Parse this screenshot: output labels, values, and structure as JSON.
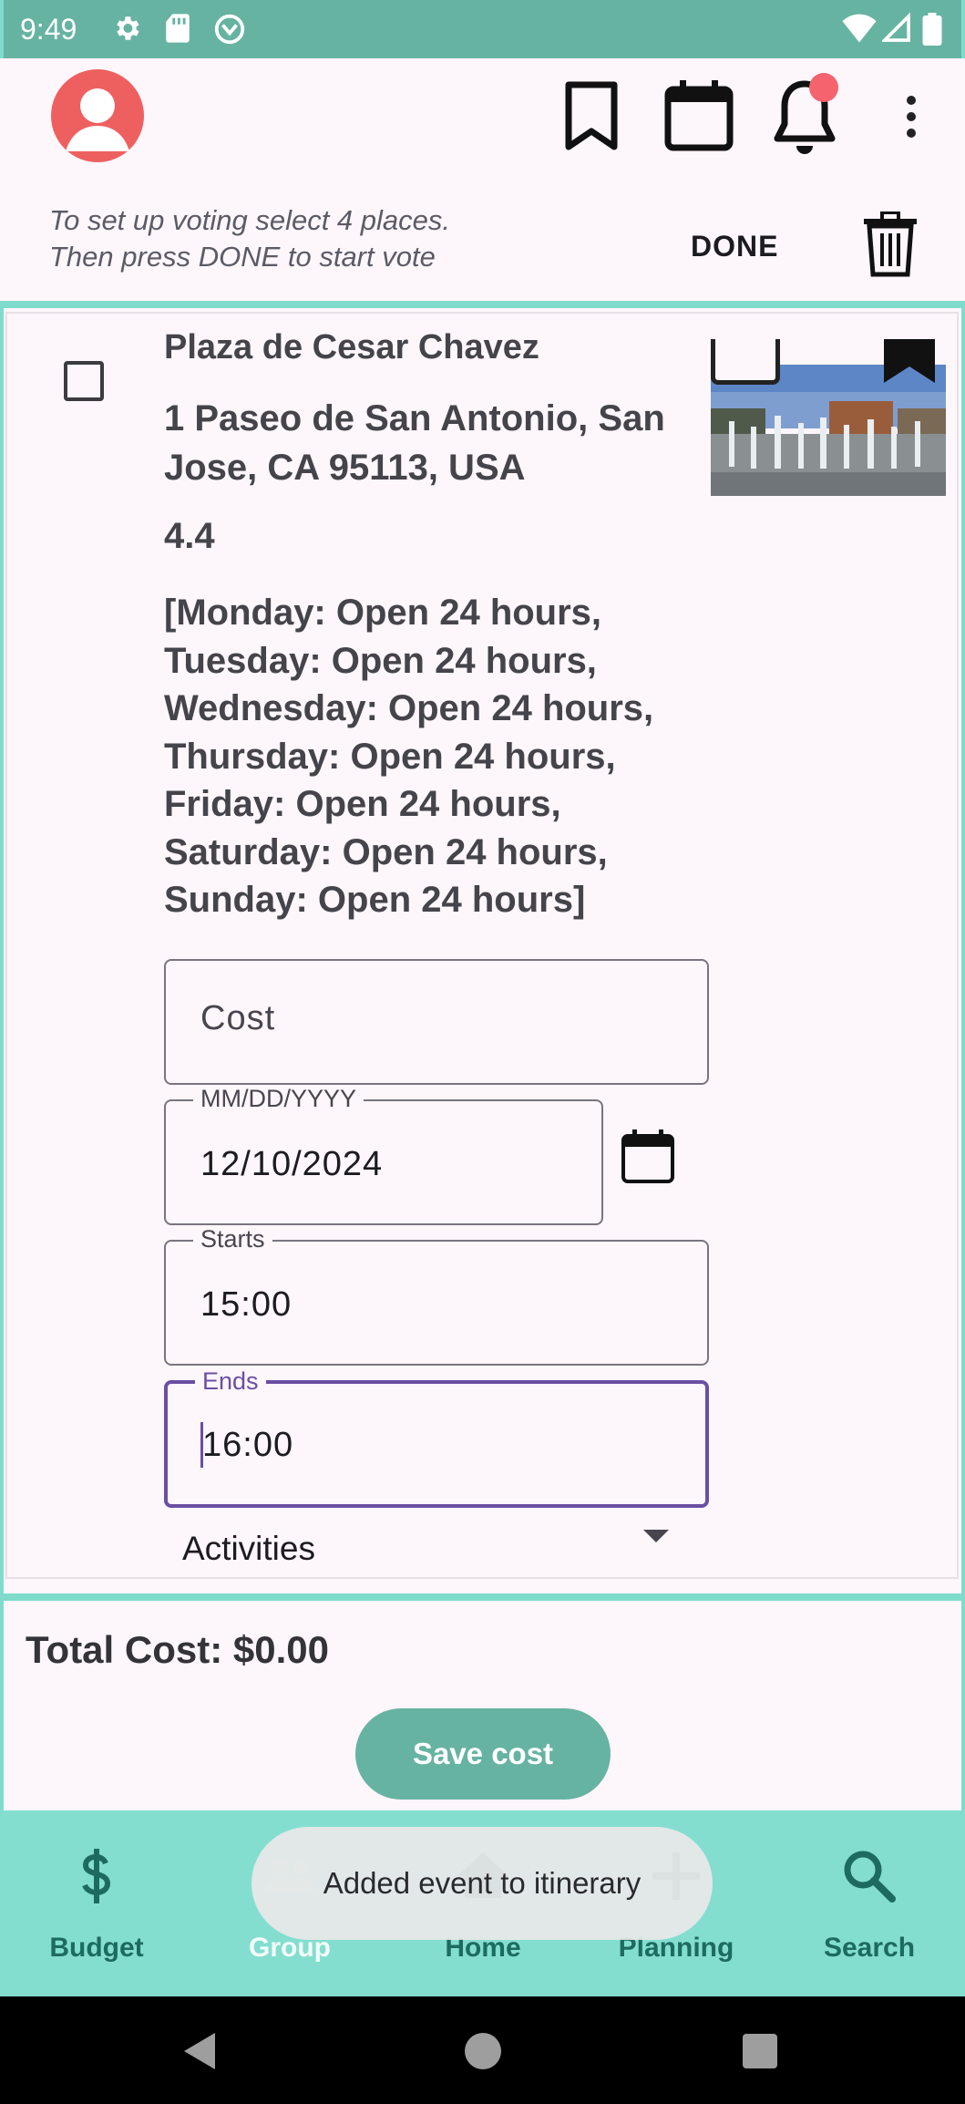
{
  "status_bar": {
    "time": "9:49",
    "left_icons": [
      "gear-icon",
      "sd-card-icon",
      "vpn-icon"
    ],
    "right_icons": [
      "wifi-icon",
      "cell-signal-icon",
      "battery-icon"
    ]
  },
  "header": {
    "instructions_line1": "To set up voting select 4 places.",
    "instructions_line2": "Then press DONE to start vote",
    "done_label": "DONE",
    "icons": [
      "avatar-icon",
      "bookmark-icon",
      "calendar-icon",
      "bell-icon",
      "more-vert-icon",
      "trash-icon"
    ]
  },
  "place": {
    "name": "Plaza de Cesar Chavez",
    "address_line1": "1 Paseo de San Antonio, San",
    "address_line2": "Jose, CA 95113, USA",
    "rating": "4.4",
    "hours": [
      "[Monday: Open 24 hours,",
      "Tuesday: Open 24 hours,",
      "Wednesday: Open 24 hours,",
      "Thursday: Open 24 hours,",
      "Friday: Open 24 hours,",
      "Saturday: Open 24 hours,",
      "Sunday: Open 24 hours]"
    ],
    "selected": false
  },
  "form": {
    "cost_placeholder": "Cost",
    "date_label": "MM/DD/YYYY",
    "date_value": "12/10/2024",
    "starts_label": "Starts",
    "starts_value": "15:00",
    "ends_label": "Ends",
    "ends_value": "16:00",
    "activities_label": "Activities"
  },
  "summary": {
    "total_cost": "Total Cost: $0.00",
    "save_label": "Save cost"
  },
  "bottom_nav": {
    "items": [
      {
        "label": "Budget",
        "icon": "dollar-icon"
      },
      {
        "label": "Group",
        "icon": "group-icon"
      },
      {
        "label": "Home",
        "icon": "home-icon"
      },
      {
        "label": "Planning",
        "icon": "plus-icon"
      },
      {
        "label": "Search",
        "icon": "search-icon"
      }
    ],
    "selected": "Group"
  },
  "toast": {
    "message": "Added event to itinerary"
  },
  "colors": {
    "status_bar": "#67b3a2",
    "accent_teal": "#7fdccc",
    "nav_bg": "#83ded0",
    "save_button": "#67b3a2",
    "focus_purple": "#6a4fa3",
    "avatar_red": "#ee6060"
  }
}
